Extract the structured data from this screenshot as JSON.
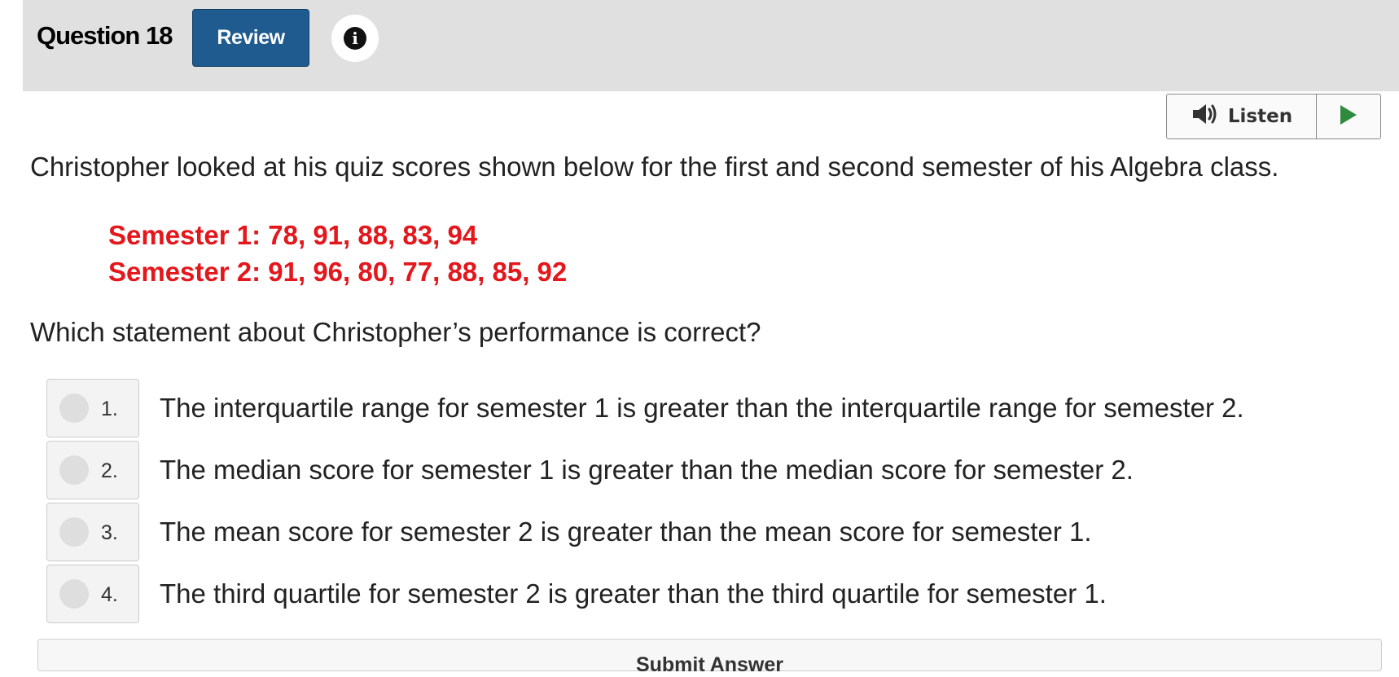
{
  "header": {
    "question_title": "Question 18",
    "review_label": "Review",
    "info_glyph": "i",
    "info_icon": "info-icon"
  },
  "listen": {
    "label": "Listen",
    "speaker_icon": "speaker-icon",
    "play_icon": "play-icon",
    "play_color": "#2e8b3e"
  },
  "question": {
    "stem": "Christopher looked at his quiz scores shown below for the first and second semester of his Algebra class.",
    "data_lines": [
      "Semester 1: 78, 91, 88, 83, 94",
      "Semester 2: 91, 96, 80, 77, 88, 85, 92"
    ],
    "data_color": "#e3171c",
    "prompt": "Which statement about Christopher’s performance is correct?"
  },
  "choices": [
    {
      "number": "1.",
      "text": "The interquartile range for semester 1 is greater than the interquartile range for semester 2."
    },
    {
      "number": "2.",
      "text": "The median score for semester 1 is greater than the median score for semester 2."
    },
    {
      "number": "3.",
      "text": "The mean score for semester 2 is greater than the mean score for semester 1."
    },
    {
      "number": "4.",
      "text": "The third quartile for semester 2 is greater than the third quartile for semester 1."
    }
  ],
  "submit": {
    "label": "Submit Answer"
  },
  "colors": {
    "header_bg": "#e0e0e0",
    "review_bg": "#1f5b8f"
  }
}
